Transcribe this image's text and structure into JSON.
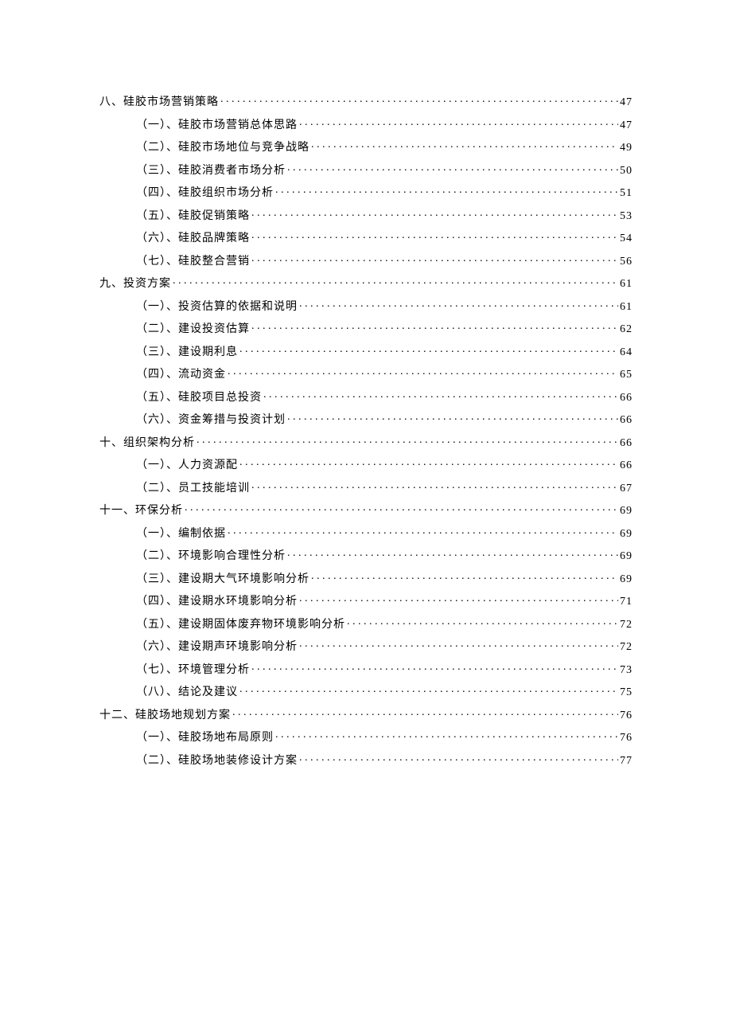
{
  "toc": [
    {
      "level": 1,
      "title": "八、硅胶市场营销策略",
      "page": "47"
    },
    {
      "level": 2,
      "title": "（一）、硅胶市场营销总体思路",
      "page": "47"
    },
    {
      "level": 2,
      "title": "（二）、硅胶市场地位与竞争战略",
      "page": "49"
    },
    {
      "level": 2,
      "title": "（三）、硅胶消费者市场分析",
      "page": "50"
    },
    {
      "level": 2,
      "title": "（四）、硅胶组织市场分析",
      "page": "51"
    },
    {
      "level": 2,
      "title": "（五）、硅胶促销策略",
      "page": "53"
    },
    {
      "level": 2,
      "title": "（六）、硅胶品牌策略",
      "page": "54"
    },
    {
      "level": 2,
      "title": "（七）、硅胶整合营销",
      "page": "56"
    },
    {
      "level": 1,
      "title": "九、投资方案",
      "page": "61"
    },
    {
      "level": 2,
      "title": "（一）、投资估算的依据和说明",
      "page": "61"
    },
    {
      "level": 2,
      "title": "（二）、建设投资估算",
      "page": "62"
    },
    {
      "level": 2,
      "title": "（三）、建设期利息",
      "page": "64"
    },
    {
      "level": 2,
      "title": "（四）、流动资金",
      "page": "65"
    },
    {
      "level": 2,
      "title": "（五）、硅胶项目总投资",
      "page": "66"
    },
    {
      "level": 2,
      "title": "（六）、资金筹措与投资计划",
      "page": "66"
    },
    {
      "level": 1,
      "title": "十、组织架构分析",
      "page": "66"
    },
    {
      "level": 2,
      "title": "（一）、人力资源配",
      "page": "66"
    },
    {
      "level": 2,
      "title": "（二）、员工技能培训",
      "page": "67"
    },
    {
      "level": 1,
      "title": "十一、环保分析",
      "page": "69"
    },
    {
      "level": 2,
      "title": "（一）、编制依据",
      "page": "69"
    },
    {
      "level": 2,
      "title": "（二）、环境影响合理性分析",
      "page": "69"
    },
    {
      "level": 2,
      "title": "（三）、建设期大气环境影响分析",
      "page": "69"
    },
    {
      "level": 2,
      "title": "（四）、建设期水环境影响分析",
      "page": "71"
    },
    {
      "level": 2,
      "title": "（五）、建设期固体废弃物环境影响分析",
      "page": "72"
    },
    {
      "level": 2,
      "title": "（六）、建设期声环境影响分析",
      "page": "72"
    },
    {
      "level": 2,
      "title": "（七）、环境管理分析",
      "page": "73"
    },
    {
      "level": 2,
      "title": "（八）、结论及建议",
      "page": "75"
    },
    {
      "level": 1,
      "title": "十二、硅胶场地规划方案",
      "page": "76"
    },
    {
      "level": 2,
      "title": "（一）、硅胶场地布局原则",
      "page": "76"
    },
    {
      "level": 2,
      "title": "（二）、硅胶场地装修设计方案",
      "page": "77"
    }
  ]
}
